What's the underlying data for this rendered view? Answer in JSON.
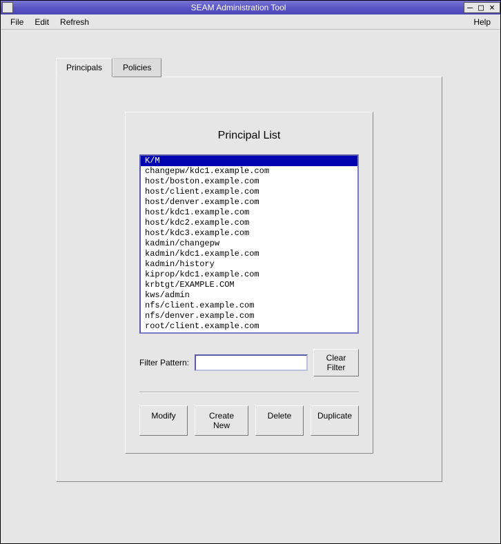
{
  "window": {
    "title": "SEAM Administration Tool"
  },
  "menubar": {
    "file": "File",
    "edit": "Edit",
    "refresh": "Refresh",
    "help": "Help"
  },
  "tabs": {
    "principals": "Principals",
    "policies": "Policies",
    "active": "principals"
  },
  "panel": {
    "heading": "Principal List",
    "items": [
      "K/M",
      "changepw/kdc1.example.com",
      "host/boston.example.com",
      "host/client.example.com",
      "host/denver.example.com",
      "host/kdc1.example.com",
      "host/kdc2.example.com",
      "host/kdc3.example.com",
      "kadmin/changepw",
      "kadmin/kdc1.example.com",
      "kadmin/history",
      "kiprop/kdc1.example.com",
      "krbtgt/EXAMPLE.COM",
      "kws/admin",
      "nfs/client.example.com",
      "nfs/denver.example.com",
      "root/client.example.com"
    ],
    "selected_index": 0,
    "filter_label": "Filter Pattern:",
    "filter_value": "",
    "clear_filter": "Clear Filter"
  },
  "actions": {
    "modify": "Modify",
    "create_new": "Create New",
    "delete": "Delete",
    "duplicate": "Duplicate"
  }
}
